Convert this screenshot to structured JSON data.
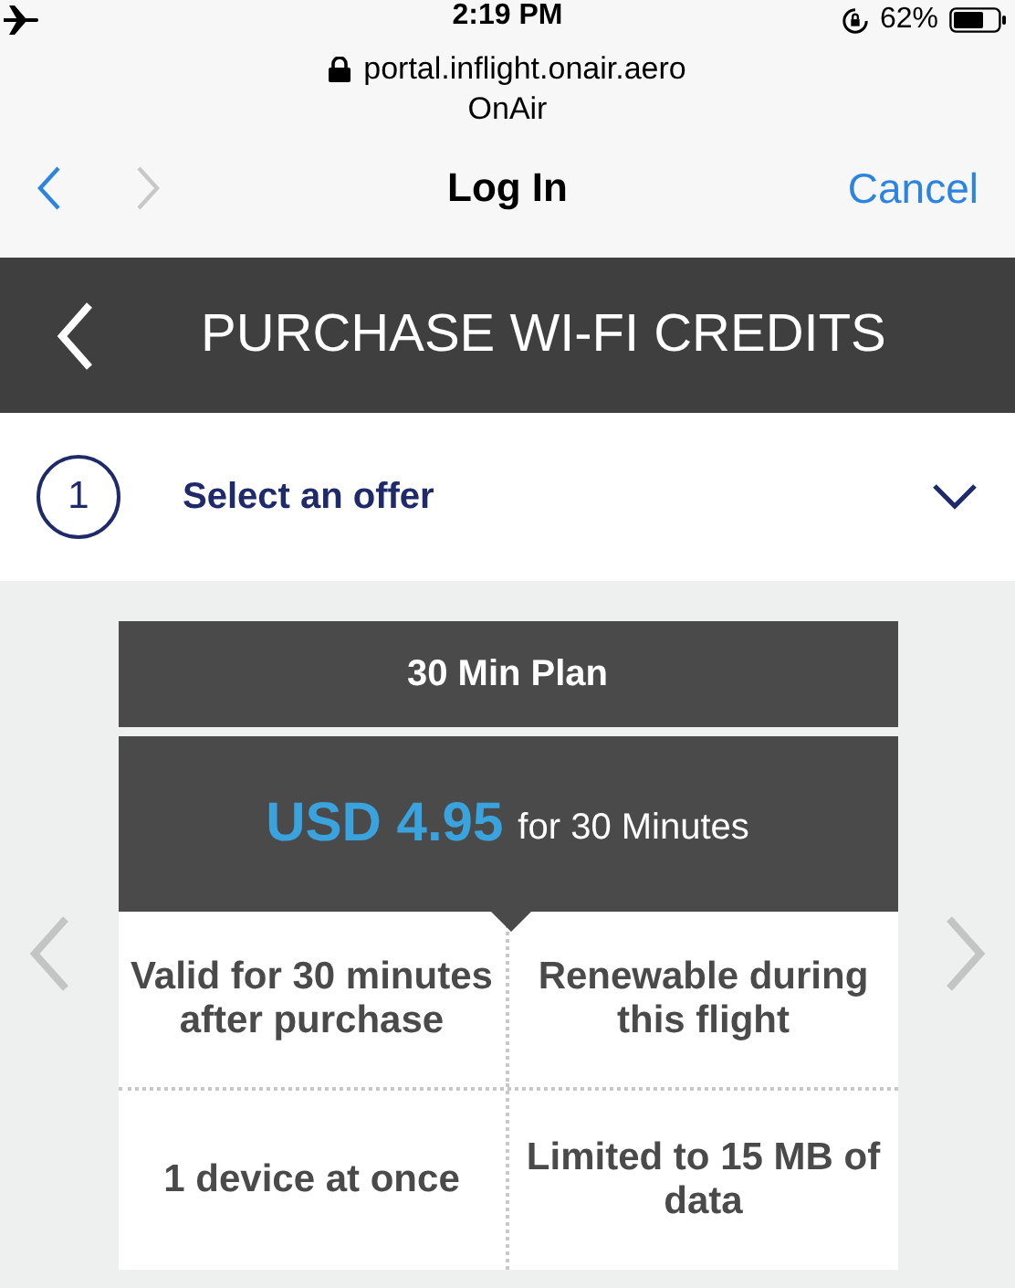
{
  "status_bar": {
    "time": "2:19 PM",
    "battery": "62%"
  },
  "browser": {
    "url": "portal.inflight.onair.aero",
    "site": "OnAir",
    "title": "Log In",
    "cancel": "Cancel",
    "back_enabled": true,
    "forward_enabled": false
  },
  "header": {
    "title": "PURCHASE WI-FI CREDITS"
  },
  "step": {
    "number": "1",
    "label": "Select an offer",
    "expanded": false
  },
  "offer": {
    "name": "30 Min Plan",
    "price": "USD 4.95",
    "duration": "for 30 Minutes",
    "feature_rows": [
      [
        "Valid for 30 minutes after purchase",
        "Renewable during this flight"
      ],
      [
        "1 device at once",
        "Limited to 15 MB of data"
      ]
    ]
  }
}
